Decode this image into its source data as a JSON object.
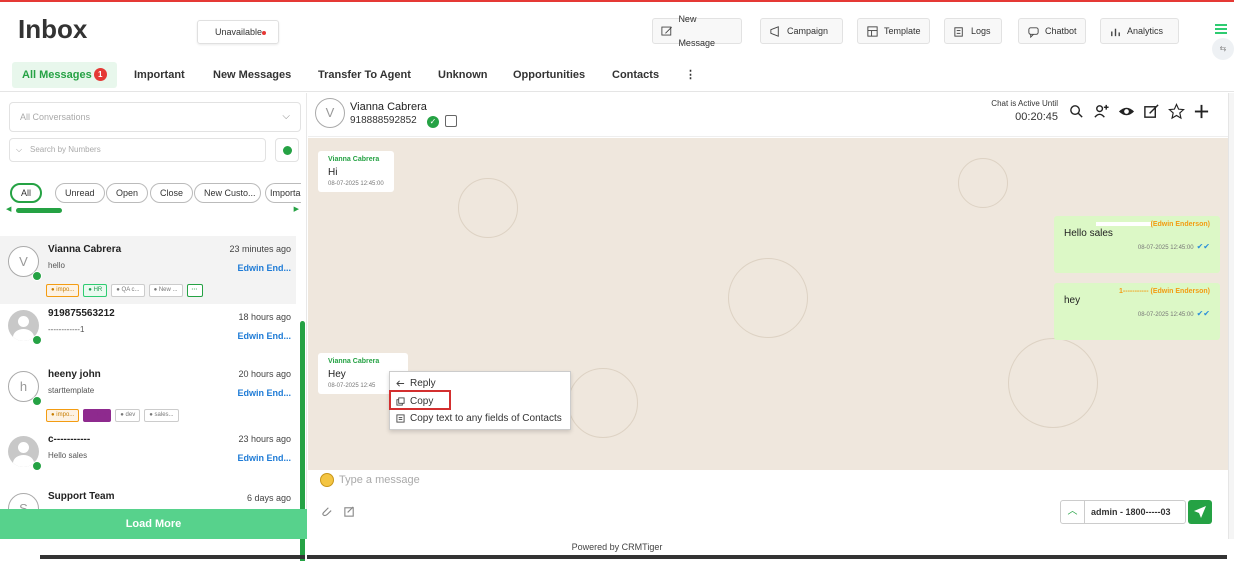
{
  "header": {
    "title": "Inbox",
    "status": "Unavailable",
    "toolbar": [
      {
        "label": "New Message",
        "icon": "new-message-icon"
      },
      {
        "label": "Campaign",
        "icon": "campaign-icon"
      },
      {
        "label": "Template",
        "icon": "template-icon"
      },
      {
        "label": "Logs",
        "icon": "logs-icon"
      },
      {
        "label": "Chatbot",
        "icon": "chatbot-icon"
      },
      {
        "label": "Analytics",
        "icon": "analytics-icon"
      }
    ]
  },
  "tabs": {
    "all_label": "All Messages",
    "all_badge": "1",
    "important": "Important",
    "new_messages": "New Messages",
    "transfer": "Transfer To Agent",
    "unknown": "Unknown",
    "opportunities": "Opportunities",
    "contacts": "Contacts",
    "more": "⋮"
  },
  "sidebar": {
    "conversation_filter": "All Conversations",
    "search_placeholder": "Search by Numbers",
    "chips": [
      "All",
      "Unread",
      "Open",
      "Close",
      "New Custo...",
      "Importar"
    ],
    "load_more": "Load More",
    "conversations": [
      {
        "initial": "V",
        "name": "Vianna Cabrera",
        "message": "hello",
        "time": "23 minutes ago",
        "agent": "Edwin End...",
        "tags": [
          "● impo...",
          "● HR",
          "● QA c...",
          "● New ...",
          "···"
        ]
      },
      {
        "initial": "",
        "name": "919875563212",
        "message": "------------1",
        "time": "18 hours ago",
        "agent": "Edwin End..."
      },
      {
        "initial": "h",
        "name": "heeny john",
        "message": "starttemplate",
        "time": "20 hours ago",
        "agent": "Edwin End...",
        "tags": [
          "● impo...",
          "● clerk",
          "● dev",
          "● sales..."
        ]
      },
      {
        "initial": "",
        "name": "c-----------",
        "message": "Hello sales",
        "time": "23 hours ago",
        "agent": "Edwin End..."
      },
      {
        "initial": "S",
        "name": "Support Team",
        "message": "",
        "time": "6 days ago",
        "agent": ""
      }
    ]
  },
  "chat": {
    "initial": "V",
    "contact_name": "Vianna Cabrera",
    "contact_number": "918888592852",
    "active_label": "Chat is Active Until",
    "active_time": "00:20:45",
    "messages": [
      {
        "sender": "Vianna Cabrera",
        "text": "Hi",
        "time": "08-07-2025 12:45:00"
      },
      {
        "sender": "(Edwin Enderson)",
        "text": "Hello sales",
        "time": "08-07-2025 12:45:00"
      },
      {
        "sender": "1----------- (Edwin Enderson)",
        "text": "hey",
        "time": "08-07-2025 12:45:00"
      },
      {
        "sender": "Vianna Cabrera",
        "text": "Hey",
        "time": "08-07-2025 12:45"
      }
    ],
    "context_menu": [
      "Reply",
      "Copy",
      "Copy text to any fields of Contacts"
    ],
    "composer_placeholder": "Type a message",
    "assignee": "admin - 1800-----03"
  },
  "footer": "Powered by CRMTiger",
  "colors": {
    "accent": "#25a244",
    "badge": "#e53935",
    "agent_link": "#1e7bd6",
    "outgoing_bubble": "#dcf8c6",
    "chat_bg": "#efe7dd"
  }
}
